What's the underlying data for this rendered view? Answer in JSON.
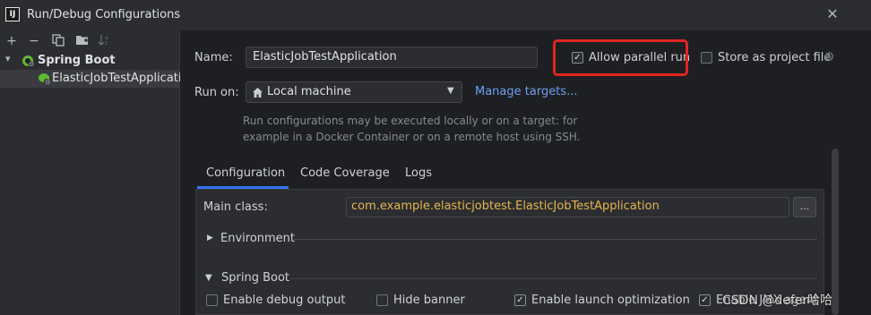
{
  "window": {
    "title": "Run/Debug Configurations"
  },
  "toolbar": {
    "add": "+",
    "remove": "−"
  },
  "tree": {
    "root_label": "Spring Boot",
    "child_label": "ElasticJobTestApplication"
  },
  "form": {
    "name_label": "Name:",
    "name_value": "ElasticJobTestApplication",
    "allow_parallel_label": "Allow parallel run",
    "allow_parallel_checked": true,
    "store_project_label": "Store as project file",
    "store_project_checked": false,
    "run_on_label": "Run on:",
    "run_on_value": "Local machine",
    "manage_targets": "Manage targets...",
    "help_line1": "Run configurations may be executed locally or on a target: for",
    "help_line2": "example in a Docker Container or on a remote host using SSH."
  },
  "tabs": [
    "Configuration",
    "Code Coverage",
    "Logs"
  ],
  "config": {
    "main_class_label": "Main class:",
    "main_class_value": "com.example.elasticjobtest.ElasticJobTestApplication",
    "browse_label": "...",
    "environment_label": "Environment",
    "spring_boot_label": "Spring Boot",
    "options": [
      {
        "label": "Enable debug output",
        "checked": false
      },
      {
        "label": "Hide banner",
        "checked": false
      },
      {
        "label": "Enable launch optimization",
        "checked": true
      },
      {
        "label": "Enable JMX agent",
        "checked": true
      }
    ]
  },
  "watermark": "CSDN @defer哈哈"
}
